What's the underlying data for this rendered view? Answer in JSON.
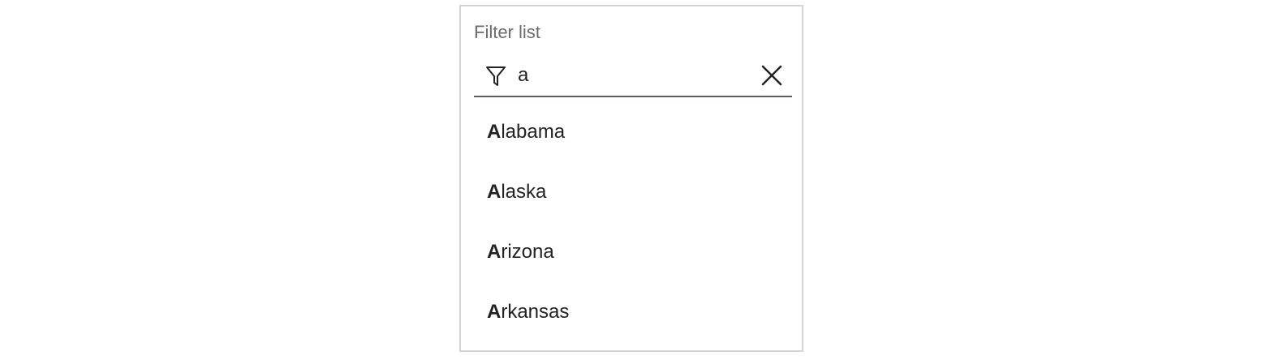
{
  "filter": {
    "label": "Filter list",
    "value": "a",
    "icon": "filter-icon",
    "clear_icon": "close-icon"
  },
  "options": [
    {
      "match": "A",
      "rest": "labama"
    },
    {
      "match": "A",
      "rest": "laska"
    },
    {
      "match": "A",
      "rest": "rizona"
    },
    {
      "match": "A",
      "rest": "rkansas"
    }
  ],
  "colors": {
    "border": "#d4d4d4",
    "label": "#6b6b6b",
    "underline": "#5c5c66",
    "text": "#222222"
  }
}
